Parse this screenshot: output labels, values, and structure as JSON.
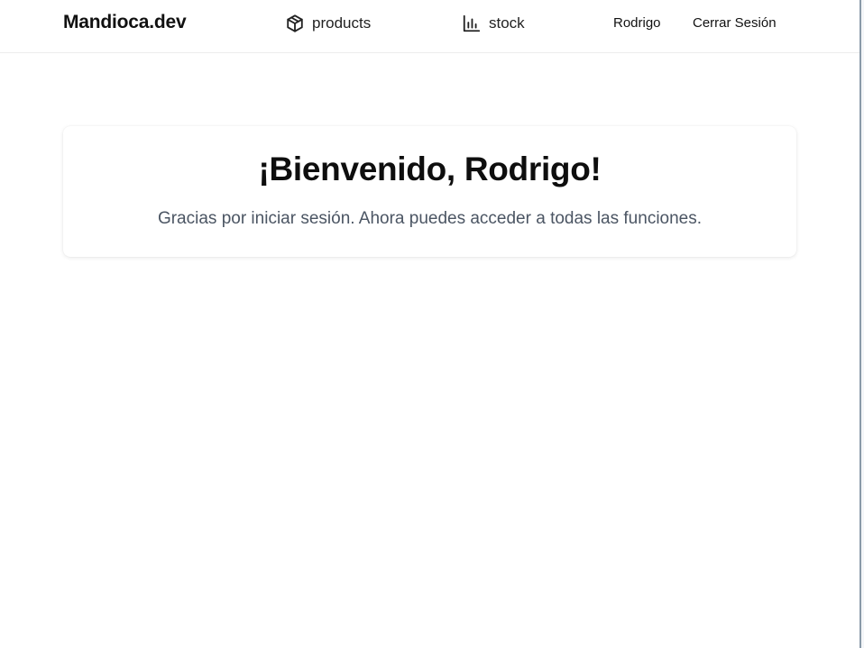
{
  "navbar": {
    "brand": "Mandioca.dev",
    "links": [
      {
        "label": "products",
        "icon": "package-icon"
      },
      {
        "label": "stock",
        "icon": "bar-chart-icon"
      }
    ],
    "user_name": "Rodrigo",
    "logout_label": "Cerrar Sesión"
  },
  "welcome": {
    "title": "¡Bienvenido, Rodrigo!",
    "message": "Gracias por iniciar sesión. Ahora puedes acceder a todas las funciones."
  },
  "colors": {
    "text_primary": "#111111",
    "text_secondary": "#4b5563",
    "background": "#ffffff",
    "nav_border": "#ececec"
  }
}
